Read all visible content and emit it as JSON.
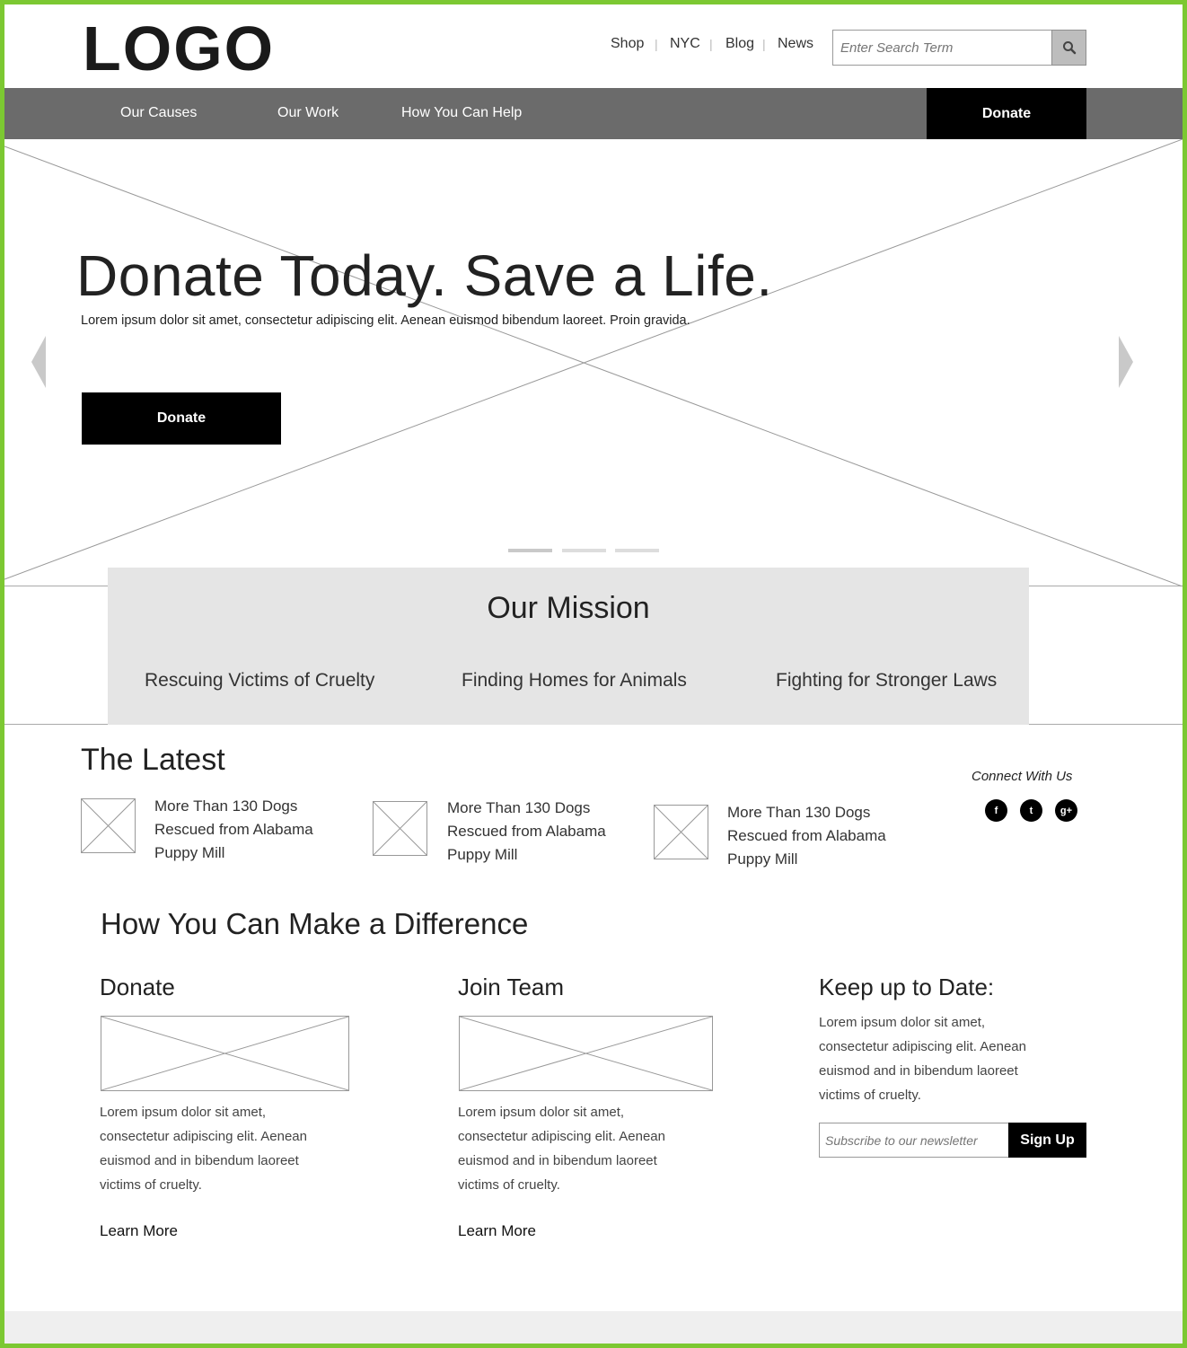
{
  "header": {
    "logo": "LOGO",
    "utility_links": [
      "Shop",
      "NYC",
      "Blog",
      "News"
    ],
    "search_placeholder": "Enter Search Term"
  },
  "nav": {
    "items": [
      "Our Causes",
      "Our Work",
      "How You Can Help"
    ],
    "donate": "Donate"
  },
  "hero": {
    "title": "Donate Today. Save a Life.",
    "subtitle": "Lorem ipsum dolor sit amet, consectetur adipiscing elit. Aenean euismod bibendum laoreet. Proin gravida.",
    "button": "Donate",
    "slide_count": 3,
    "active_slide": 1
  },
  "mission": {
    "title": "Our Mission",
    "items": [
      "Rescuing Victims of Cruelty",
      "Finding Homes for Animals",
      "Fighting for Stronger Laws"
    ]
  },
  "latest": {
    "title": "The Latest",
    "articles": [
      {
        "line1": "More Than 130 Dogs",
        "line2": "Rescued from Alabama",
        "line3": "Puppy Mill"
      },
      {
        "line1": "More Than 130 Dogs",
        "line2": "Rescued from Alabama",
        "line3": "Puppy Mill"
      },
      {
        "line1": "More Than 130 Dogs",
        "line2": "Rescued from Alabama",
        "line3": "Puppy Mill"
      }
    ],
    "connect_label": "Connect With Us",
    "social": [
      {
        "icon": "facebook-icon",
        "glyph": "f"
      },
      {
        "icon": "twitter-icon",
        "glyph": "t"
      },
      {
        "icon": "google-plus-icon",
        "glyph": "g+"
      }
    ]
  },
  "difference": {
    "title": "How You Can Make a Difference",
    "columns": [
      {
        "title": "Donate",
        "lines": [
          "Lorem ipsum dolor sit amet,",
          "consectetur adipiscing elit. Aenean",
          "euismod and in bibendum laoreet",
          "victims of cruelty."
        ],
        "link": "Learn More"
      },
      {
        "title": "Join Team",
        "lines": [
          "Lorem ipsum dolor sit amet,",
          "consectetur adipiscing elit. Aenean",
          "euismod and in bibendum laoreet",
          "victims of cruelty."
        ],
        "link": "Learn More"
      }
    ],
    "keep": {
      "title": "Keep up to Date:",
      "lines": [
        "Lorem ipsum dolor sit amet,",
        "consectetur adipiscing elit. Aenean",
        "euismod and in bibendum laoreet",
        "victims of cruelty."
      ],
      "placeholder": "Subscribe to our newsletter",
      "button": "Sign Up"
    }
  },
  "colors": {
    "frame": "#7cc832",
    "nav_bg": "#6b6b6b",
    "button_bg": "#000000",
    "mission_bg": "#e5e5e5"
  }
}
